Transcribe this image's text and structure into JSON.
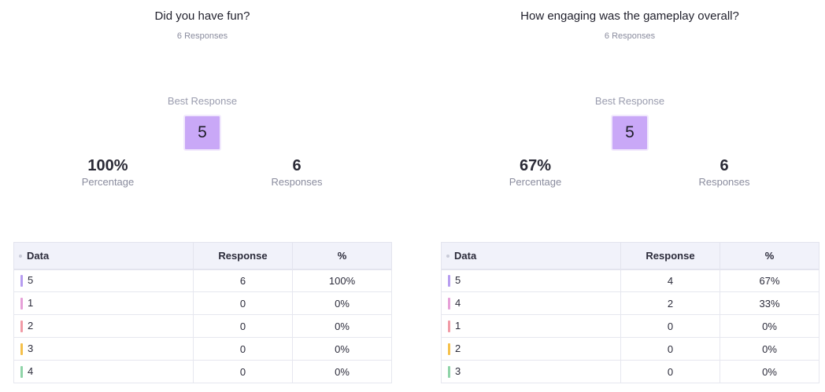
{
  "panels": [
    {
      "question": "Did you have fun?",
      "response_count": "6 Responses",
      "best_label": "Best Response",
      "best_value": "5",
      "percentage_value": "100%",
      "percentage_label": "Percentage",
      "responses_value": "6",
      "responses_label": "Responses",
      "table": {
        "headers": [
          "Data",
          "Response",
          "%"
        ],
        "rows": [
          {
            "data": "5",
            "response": "6",
            "pct": "100%",
            "color": "#b69cf0"
          },
          {
            "data": "1",
            "response": "0",
            "pct": "0%",
            "color": "#e6a0d8"
          },
          {
            "data": "2",
            "response": "0",
            "pct": "0%",
            "color": "#f19aa6"
          },
          {
            "data": "3",
            "response": "0",
            "pct": "0%",
            "color": "#f5c04a"
          },
          {
            "data": "4",
            "response": "0",
            "pct": "0%",
            "color": "#8fd4a8"
          }
        ]
      }
    },
    {
      "question": "How engaging was the gameplay overall?",
      "response_count": "6 Responses",
      "best_label": "Best Response",
      "best_value": "5",
      "percentage_value": "67%",
      "percentage_label": "Percentage",
      "responses_value": "6",
      "responses_label": "Responses",
      "table": {
        "headers": [
          "Data",
          "Response",
          "%"
        ],
        "rows": [
          {
            "data": "5",
            "response": "4",
            "pct": "67%",
            "color": "#b69cf0"
          },
          {
            "data": "4",
            "response": "2",
            "pct": "33%",
            "color": "#e6a0d8"
          },
          {
            "data": "1",
            "response": "0",
            "pct": "0%",
            "color": "#f19aa6"
          },
          {
            "data": "2",
            "response": "0",
            "pct": "0%",
            "color": "#f5c04a"
          },
          {
            "data": "3",
            "response": "0",
            "pct": "0%",
            "color": "#8fd4a8"
          }
        ]
      }
    }
  ]
}
